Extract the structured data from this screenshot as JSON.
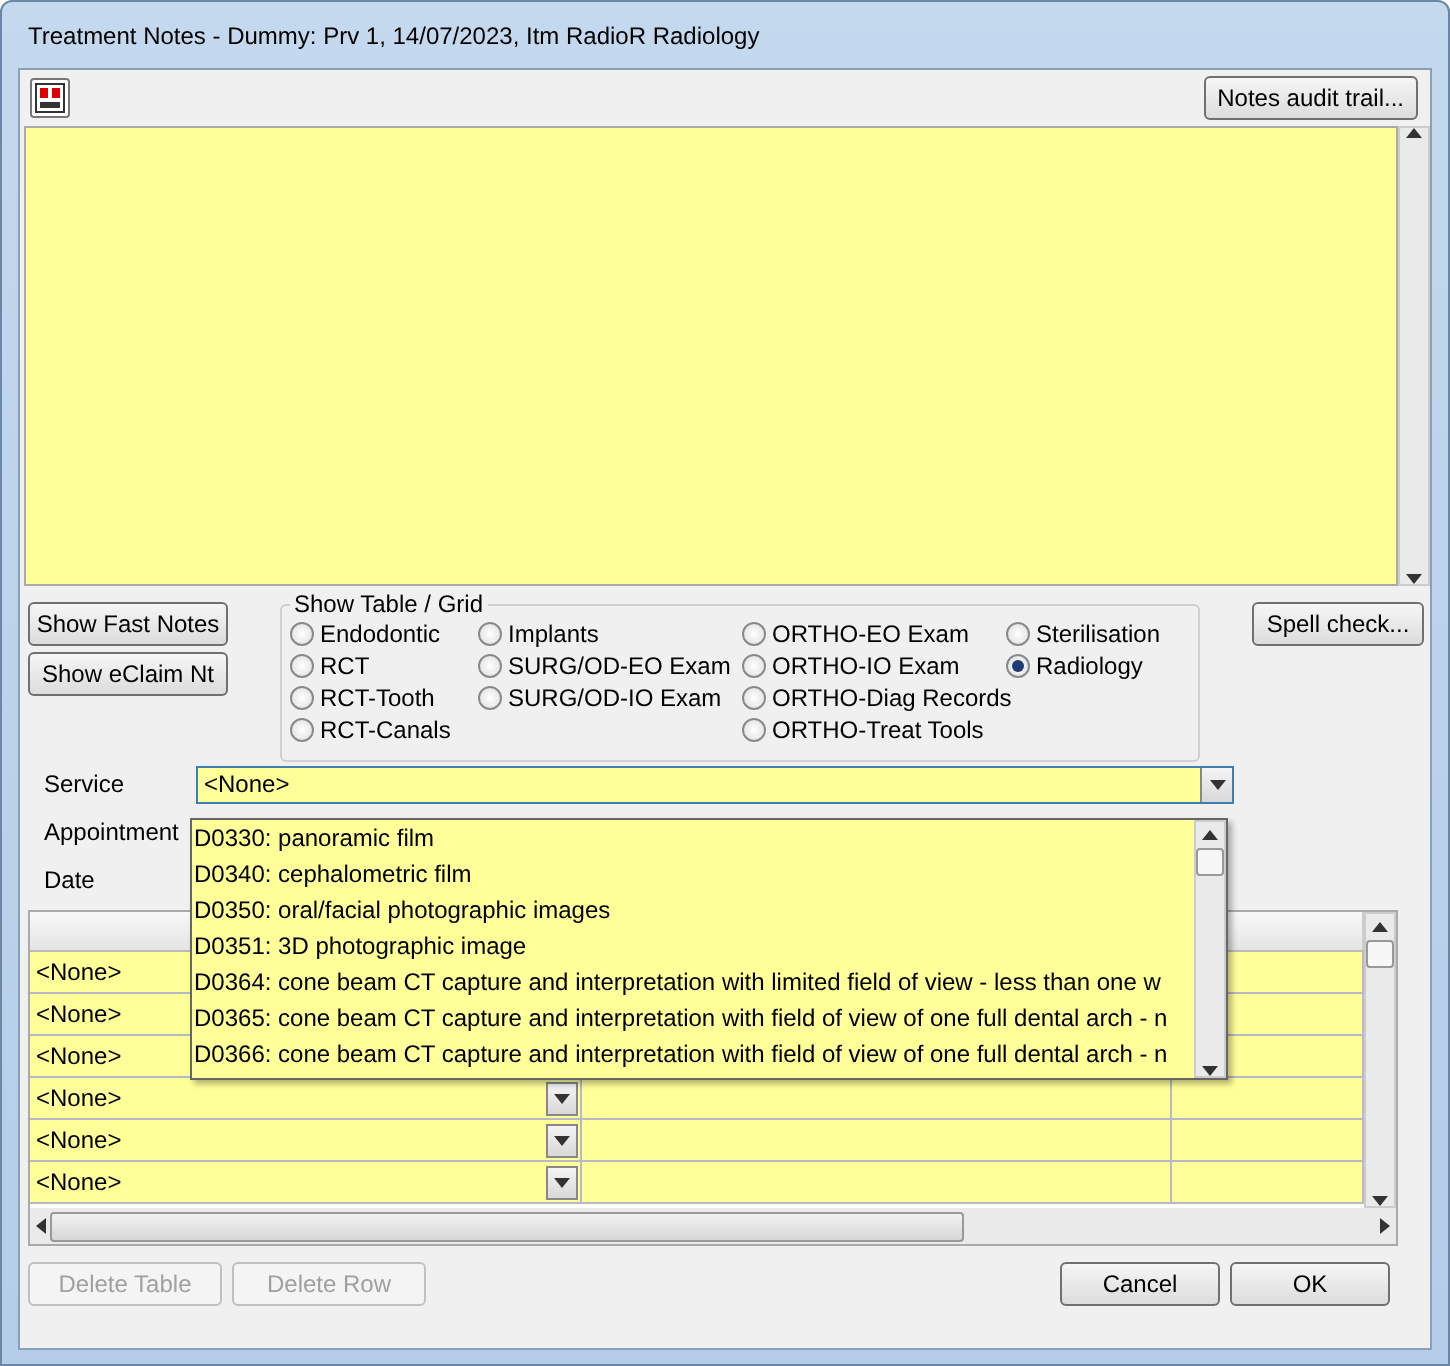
{
  "window": {
    "title": "Treatment Notes - Dummy: Prv 1, 14/07/2023, Itm RadioR Radiology"
  },
  "toolbar": {
    "audit_button": "Notes audit trail..."
  },
  "side_buttons": [
    "Show Fast Notes",
    "Show eClaim Nt"
  ],
  "table_grid_group": {
    "title": "Show Table / Grid",
    "columns": [
      {
        "options": [
          {
            "label": "Endodontic",
            "selected": false
          },
          {
            "label": "RCT",
            "selected": false
          },
          {
            "label": "RCT-Tooth",
            "selected": false
          },
          {
            "label": "RCT-Canals",
            "selected": false
          }
        ]
      },
      {
        "options": [
          {
            "label": "Implants",
            "selected": false
          },
          {
            "label": "SURG/OD-EO Exam",
            "selected": false
          },
          {
            "label": "SURG/OD-IO Exam",
            "selected": false
          }
        ]
      },
      {
        "options": [
          {
            "label": "ORTHO-EO Exam",
            "selected": false
          },
          {
            "label": "ORTHO-IO Exam",
            "selected": false
          },
          {
            "label": "ORTHO-Diag Records",
            "selected": false
          },
          {
            "label": "ORTHO-Treat Tools",
            "selected": false
          }
        ]
      },
      {
        "options": [
          {
            "label": "Sterilisation",
            "selected": false
          },
          {
            "label": "Radiology",
            "selected": true
          }
        ]
      }
    ]
  },
  "spell_check_button": "Spell check...",
  "form": {
    "service": {
      "label": "Service",
      "value": "<None>",
      "expanded": true
    },
    "appointment": {
      "label": "Appointment"
    },
    "date": {
      "label": "Date"
    }
  },
  "service_dropdown": {
    "items": [
      "D0330: panoramic film",
      "D0340: cephalometric film",
      "D0350: oral/facial photographic images",
      "D0351: 3D photographic image",
      "D0364: cone beam CT capture and interpretation with limited field of view - less than one w",
      "D0365: cone beam CT capture and interpretation with field of view of one full dental arch - n",
      "D0366: cone beam CT capture and interpretation with field of view of one full dental arch - n"
    ]
  },
  "grid": {
    "rows": [
      {
        "column_1": "<None>"
      },
      {
        "column_1": "<None>"
      },
      {
        "column_1": "<None>"
      },
      {
        "column_1": "<None>"
      },
      {
        "column_1": "<None>"
      },
      {
        "column_1": "<None>"
      }
    ]
  },
  "buttons": [
    {
      "label": "Delete Table",
      "disabled": true
    },
    {
      "label": "Delete Row",
      "disabled": true
    },
    {
      "label": "Cancel",
      "disabled": false
    },
    {
      "label": "OK",
      "disabled": false
    }
  ]
}
